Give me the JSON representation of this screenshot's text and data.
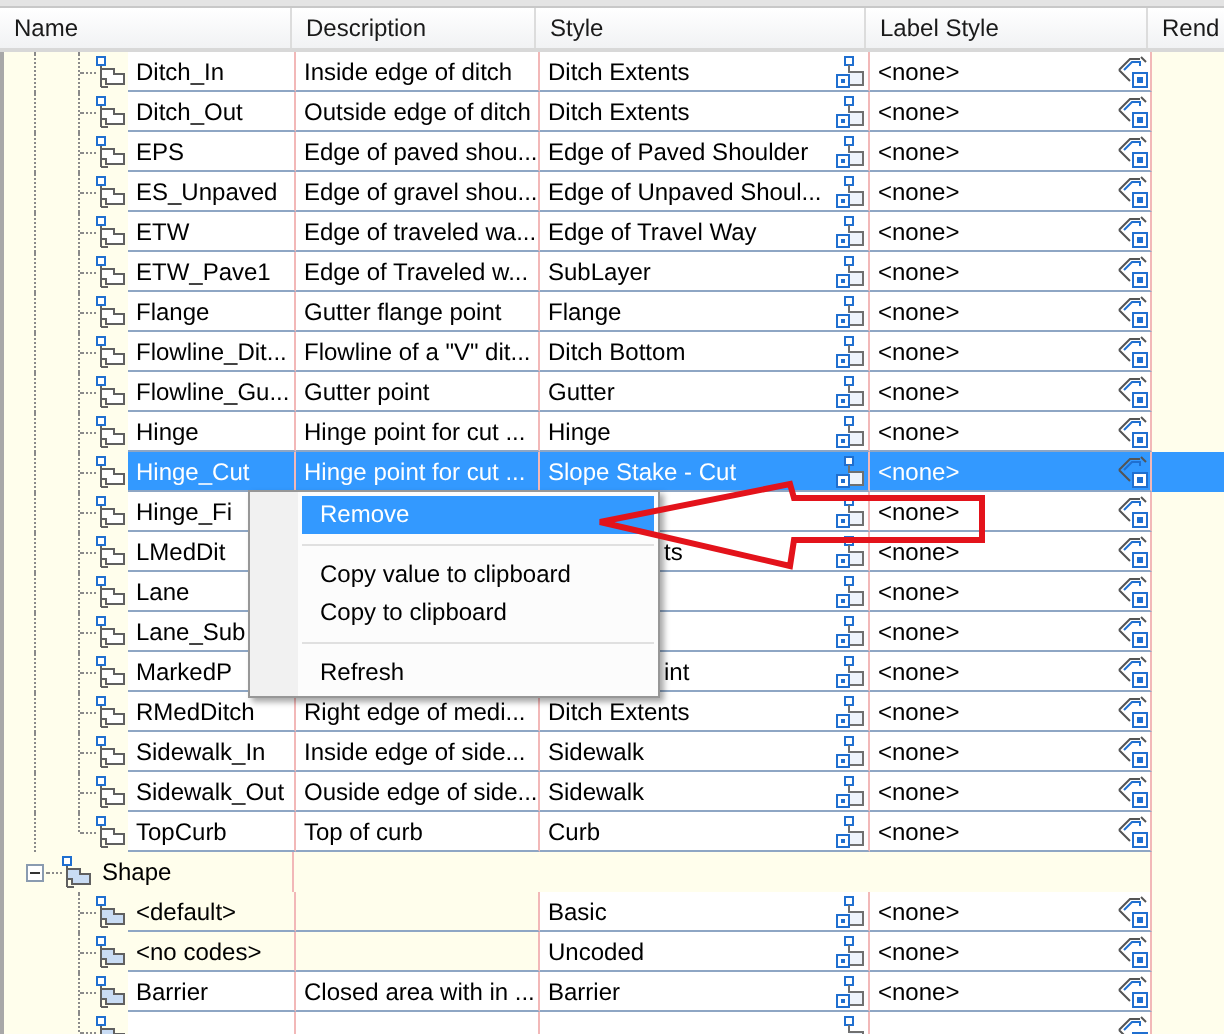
{
  "columns": [
    "Name",
    "Description",
    "Style",
    "Label Style",
    "Rend"
  ],
  "tree": [
    {
      "kind": "points",
      "children": [
        {
          "name": "Ditch_In",
          "description": "Inside edge of ditch",
          "style": "Ditch Extents",
          "label_style": "<none>",
          "selected": false
        },
        {
          "name": "Ditch_Out",
          "description": "Outside edge of ditch",
          "style": "Ditch Extents",
          "label_style": "<none>",
          "selected": false
        },
        {
          "name": "EPS",
          "description": "Edge of paved shou...",
          "style": "Edge of Paved Shoulder",
          "label_style": "<none>",
          "selected": false
        },
        {
          "name": "ES_Unpaved",
          "description": "Edge of gravel shou...",
          "style": "Edge of Unpaved Shoul...",
          "label_style": "<none>",
          "selected": false
        },
        {
          "name": "ETW",
          "description": "Edge of traveled wa...",
          "style": "Edge of Travel Way",
          "label_style": "<none>",
          "selected": false
        },
        {
          "name": "ETW_Pave1",
          "description": "Edge of Traveled w...",
          "style": "SubLayer",
          "label_style": "<none>",
          "selected": false
        },
        {
          "name": "Flange",
          "description": "Gutter flange point",
          "style": "Flange",
          "label_style": "<none>",
          "selected": false
        },
        {
          "name": "Flowline_Dit...",
          "description": "Flowline of a \"V\" dit...",
          "style": "Ditch Bottom",
          "label_style": "<none>",
          "selected": false
        },
        {
          "name": "Flowline_Gu...",
          "description": "Gutter point",
          "style": "Gutter",
          "label_style": "<none>",
          "selected": false
        },
        {
          "name": "Hinge",
          "description": "Hinge point for cut ...",
          "style": "Hinge",
          "label_style": "<none>",
          "selected": false
        },
        {
          "name": "Hinge_Cut",
          "description": "Hinge point for cut ...",
          "style": "Slope Stake - Cut",
          "label_style": "<none>",
          "selected": true
        },
        {
          "name": "Hinge_Fi",
          "label_style": "<none>",
          "selected": false
        },
        {
          "name": "LMedDit",
          "style": "ts",
          "label_style": "<none>",
          "selected": false
        },
        {
          "name": "Lane",
          "label_style": "<none>",
          "selected": false
        },
        {
          "name": "Lane_Sub",
          "label_style": "<none>",
          "selected": false
        },
        {
          "name": "MarkedP",
          "style": "int",
          "label_style": "<none>",
          "selected": false
        },
        {
          "name": "RMedDitch",
          "description": "Right edge of medi...",
          "style": "Ditch Extents",
          "label_style": "<none>",
          "selected": false
        },
        {
          "name": "Sidewalk_In",
          "description": "Inside edge of side...",
          "style": "Sidewalk",
          "label_style": "<none>",
          "selected": false
        },
        {
          "name": "Sidewalk_Out",
          "description": "Ouside edge of side...",
          "style": "Sidewalk",
          "label_style": "<none>",
          "selected": false
        },
        {
          "name": "TopCurb",
          "description": "Top of curb",
          "style": "Curb",
          "label_style": "<none>",
          "selected": false
        }
      ]
    },
    {
      "kind": "shapes",
      "name": "Shape",
      "expanded": true,
      "children": [
        {
          "name": "<default>",
          "style": "Basic",
          "label_style": "<none>",
          "selected": false,
          "readonly": true
        },
        {
          "name": "<no codes>",
          "style": "Uncoded",
          "label_style": "<none>",
          "selected": false,
          "readonly": true
        },
        {
          "name": "Barrier",
          "description": "Closed area with in ...",
          "style": "Barrier",
          "label_style": "<none>",
          "selected": false
        },
        {
          "selected": false
        }
      ]
    }
  ],
  "context_menu": [
    {
      "kind": "item",
      "label": "Remove",
      "highlighted": true
    },
    {
      "kind": "separator"
    },
    {
      "kind": "item",
      "label": "Copy value to clipboard",
      "highlighted": false
    },
    {
      "kind": "item",
      "label": "Copy to clipboard",
      "highlighted": false
    },
    {
      "kind": "separator"
    },
    {
      "kind": "item",
      "label": "Refresh",
      "highlighted": false
    }
  ]
}
